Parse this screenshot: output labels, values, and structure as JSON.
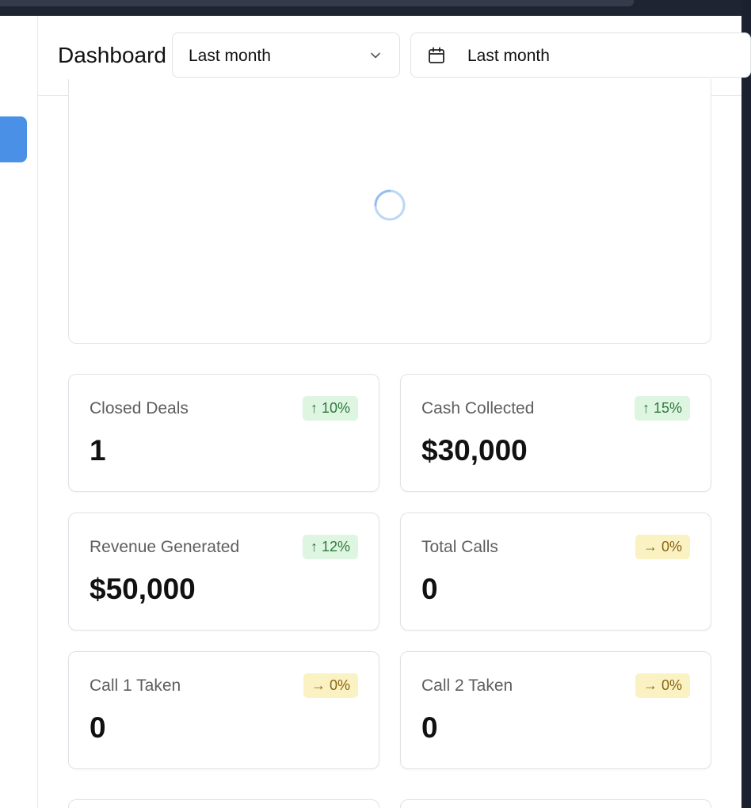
{
  "header": {
    "title": "Dashboard",
    "period_select": {
      "value": "Last month",
      "icon": "chevron-down-icon"
    },
    "date_picker": {
      "value": "Last month",
      "icon": "calendar-icon"
    }
  },
  "chart_panel": {
    "state": "loading",
    "icon": "spinner-icon"
  },
  "stats": [
    {
      "label": "Closed Deals",
      "value": "1",
      "change": "10%",
      "trend": "up",
      "arrow": "↑"
    },
    {
      "label": "Cash Collected",
      "value": "$30,000",
      "change": "15%",
      "trend": "up",
      "arrow": "↑"
    },
    {
      "label": "Revenue Generated",
      "value": "$50,000",
      "change": "12%",
      "trend": "up",
      "arrow": "↑"
    },
    {
      "label": "Total Calls",
      "value": "0",
      "change": "0%",
      "trend": "flat",
      "arrow": "→"
    },
    {
      "label": "Call 1 Taken",
      "value": "0",
      "change": "0%",
      "trend": "flat",
      "arrow": "→"
    },
    {
      "label": "Call 2 Taken",
      "value": "0",
      "change": "0%",
      "trend": "flat",
      "arrow": "→"
    }
  ],
  "colors": {
    "accent": "#4a90e6",
    "trend_up_bg": "#def5e2",
    "trend_up_text": "#2e7a3c",
    "trend_flat_bg": "#fbf2c4",
    "trend_flat_text": "#8a6410"
  }
}
